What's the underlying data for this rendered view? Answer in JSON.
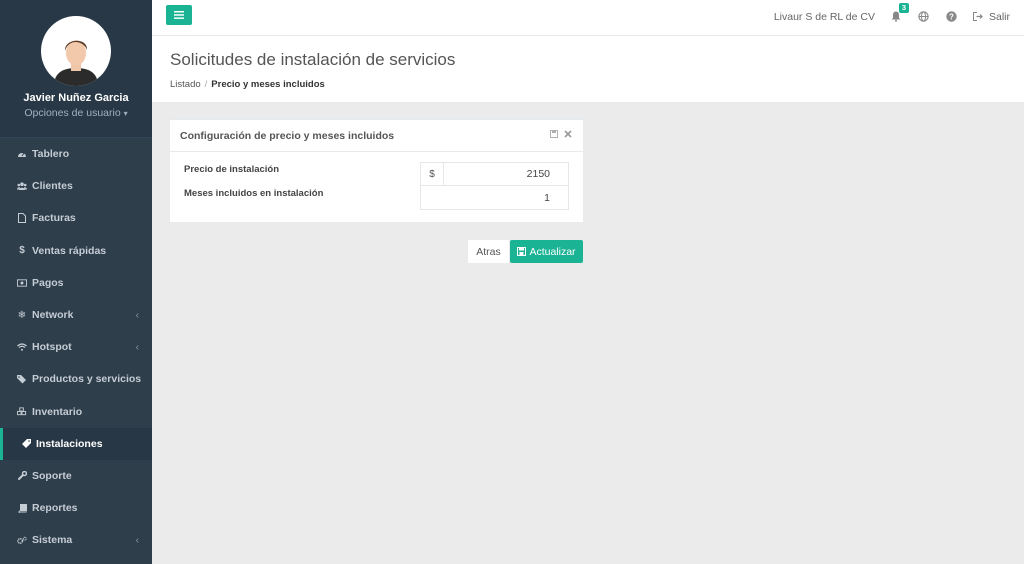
{
  "sidebar": {
    "user_name": "Javier Nuñez Garcia",
    "user_options": "Opciones de usuario",
    "items": [
      {
        "label": "Tablero",
        "icon": "dashboard-icon"
      },
      {
        "label": "Clientes",
        "icon": "users-icon"
      },
      {
        "label": "Facturas",
        "icon": "document-icon"
      },
      {
        "label": "Ventas rápidas",
        "icon": "dollar-icon"
      },
      {
        "label": "Pagos",
        "icon": "money-icon"
      },
      {
        "label": "Network",
        "icon": "snowflake-icon",
        "has_submenu": true
      },
      {
        "label": "Hotspot",
        "icon": "wifi-icon",
        "has_submenu": true
      },
      {
        "label": "Productos y servicios",
        "icon": "tags-icon"
      },
      {
        "label": "Inventario",
        "icon": "cubes-icon"
      },
      {
        "label": "Instalaciones",
        "icon": "tag-icon",
        "active": true
      },
      {
        "label": "Soporte",
        "icon": "wrench-icon"
      },
      {
        "label": "Reportes",
        "icon": "book-icon"
      },
      {
        "label": "Sistema",
        "icon": "cogs-icon",
        "has_submenu": true
      }
    ]
  },
  "topbar": {
    "company": "Livaur S de RL de CV",
    "notifications_count": "3",
    "logout_label": "Salir"
  },
  "header": {
    "title": "Solicitudes de instalación de servicios",
    "breadcrumb": {
      "item1": "Listado",
      "current": "Precio y meses incluidos"
    }
  },
  "panel": {
    "title": "Configuración de precio y meses incluidos",
    "price_label": "Precio de instalación",
    "currency_symbol": "$",
    "price_value": "2150",
    "months_label": "Meses incluidos en instalación",
    "months_value": "1"
  },
  "actions": {
    "back_label": "Atras",
    "update_label": "Actualizar"
  },
  "colors": {
    "accent": "#1ab394",
    "sidebar_bg": "#2f3e4b"
  }
}
